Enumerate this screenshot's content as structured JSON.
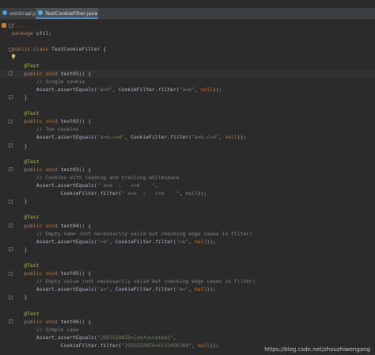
{
  "tabs": [
    {
      "label": "ootstrap.java",
      "close": "×",
      "icon": "class-icon",
      "active": false
    },
    {
      "label": "TestCookieFilter.java",
      "close": "×",
      "icon": "test-class-icon",
      "active": true
    }
  ],
  "code": [
    {
      "segments": [
        {
          "t": "/...",
          "c": "cmt"
        }
      ],
      "fold": true,
      "bookmark": true
    },
    {
      "segments": [
        {
          "t": "package",
          "c": "kw"
        },
        {
          "t": " util;",
          "c": ""
        }
      ]
    },
    {
      "segments": []
    },
    {
      "segments": [
        {
          "t": "public class ",
          "c": "kw"
        },
        {
          "t": "TestCookieFilter ",
          "c": ""
        },
        {
          "t": "{",
          "c": ""
        }
      ],
      "fold": true
    },
    {
      "segments": [
        {
          "t": "",
          "c": ""
        }
      ],
      "bulb": true
    },
    {
      "segments": [
        {
          "t": "    @Test",
          "c": "ann"
        }
      ]
    },
    {
      "segments": [
        {
          "t": "    public void ",
          "c": "kw"
        },
        {
          "t": "test01() {",
          "c": ""
        }
      ],
      "fold": true,
      "current": true
    },
    {
      "segments": [
        {
          "t": "        // Single cookie",
          "c": "cmt"
        }
      ]
    },
    {
      "segments": [
        {
          "t": "        Assert.",
          "c": ""
        },
        {
          "t": "assertEquals",
          "c": "ital"
        },
        {
          "t": "(",
          "c": ""
        },
        {
          "t": "\"a=b\"",
          "c": "str"
        },
        {
          "t": ", CookieFilter.",
          "c": ""
        },
        {
          "t": "filter",
          "c": "ital"
        },
        {
          "t": "(",
          "c": ""
        },
        {
          "t": "\"a=b\"",
          "c": "str"
        },
        {
          "t": ", ",
          "c": ""
        },
        {
          "t": "null",
          "c": "kw"
        },
        {
          "t": "));",
          "c": ""
        }
      ]
    },
    {
      "segments": [
        {
          "t": "    }",
          "c": ""
        }
      ],
      "fold": true
    },
    {
      "segments": []
    },
    {
      "segments": [
        {
          "t": "    @Test",
          "c": "ann"
        }
      ]
    },
    {
      "segments": [
        {
          "t": "    public void ",
          "c": "kw"
        },
        {
          "t": "test02() {",
          "c": ""
        }
      ],
      "fold": true
    },
    {
      "segments": [
        {
          "t": "        // Two cookies",
          "c": "cmt"
        }
      ]
    },
    {
      "segments": [
        {
          "t": "        Assert.",
          "c": ""
        },
        {
          "t": "assertEquals",
          "c": "ital"
        },
        {
          "t": "(",
          "c": ""
        },
        {
          "t": "\"a=b;c=d\"",
          "c": "str"
        },
        {
          "t": ", CookieFilter.",
          "c": ""
        },
        {
          "t": "filter",
          "c": "ital"
        },
        {
          "t": "(",
          "c": ""
        },
        {
          "t": "\"a=b;c=d\"",
          "c": "str"
        },
        {
          "t": ", ",
          "c": ""
        },
        {
          "t": "null",
          "c": "kw"
        },
        {
          "t": "));",
          "c": ""
        }
      ]
    },
    {
      "segments": [
        {
          "t": "    }",
          "c": ""
        }
      ],
      "fold": true
    },
    {
      "segments": []
    },
    {
      "segments": [
        {
          "t": "    @Test",
          "c": "ann"
        }
      ]
    },
    {
      "segments": [
        {
          "t": "    public void ",
          "c": "kw"
        },
        {
          "t": "test03() {",
          "c": ""
        }
      ],
      "fold": true
    },
    {
      "segments": [
        {
          "t": "        // Cookies with leading and trailing whitespace",
          "c": "cmt"
        }
      ]
    },
    {
      "segments": [
        {
          "t": "        Assert.",
          "c": ""
        },
        {
          "t": "assertEquals",
          "c": "ital"
        },
        {
          "t": "(",
          "c": ""
        },
        {
          "t": "\" a=b  ;   c=d    \"",
          "c": "str"
        },
        {
          "t": ",",
          "c": ""
        }
      ]
    },
    {
      "segments": [
        {
          "t": "                CookieFilter.",
          "c": ""
        },
        {
          "t": "filter",
          "c": "ital"
        },
        {
          "t": "(",
          "c": ""
        },
        {
          "t": "\" a=b  ;   c=d    \"",
          "c": "str"
        },
        {
          "t": ", ",
          "c": ""
        },
        {
          "t": "null",
          "c": "kw"
        },
        {
          "t": "));",
          "c": ""
        }
      ]
    },
    {
      "segments": [
        {
          "t": "    }",
          "c": ""
        }
      ],
      "fold": true
    },
    {
      "segments": []
    },
    {
      "segments": [
        {
          "t": "    @Test",
          "c": "ann"
        }
      ]
    },
    {
      "segments": [
        {
          "t": "    public void ",
          "c": "kw"
        },
        {
          "t": "test04() {",
          "c": ""
        }
      ],
      "fold": true
    },
    {
      "segments": [
        {
          "t": "        // Empty name (not necessarily valid but checking edge cases in filter)",
          "c": "cmt"
        }
      ]
    },
    {
      "segments": [
        {
          "t": "        Assert.",
          "c": ""
        },
        {
          "t": "assertEquals",
          "c": "ital"
        },
        {
          "t": "(",
          "c": ""
        },
        {
          "t": "\"=b\"",
          "c": "str"
        },
        {
          "t": ", CookieFilter.",
          "c": ""
        },
        {
          "t": "filter",
          "c": "ital"
        },
        {
          "t": "(",
          "c": ""
        },
        {
          "t": "\"=b\"",
          "c": "str"
        },
        {
          "t": ", ",
          "c": ""
        },
        {
          "t": "null",
          "c": "kw"
        },
        {
          "t": "));",
          "c": ""
        }
      ]
    },
    {
      "segments": [
        {
          "t": "    }",
          "c": ""
        }
      ],
      "fold": true
    },
    {
      "segments": []
    },
    {
      "segments": [
        {
          "t": "    @Test",
          "c": "ann"
        }
      ]
    },
    {
      "segments": [
        {
          "t": "    public void ",
          "c": "kw"
        },
        {
          "t": "test05() {",
          "c": ""
        }
      ],
      "fold": true
    },
    {
      "segments": [
        {
          "t": "        // Empty value (not necessarily valid but checking edge cases in filter)",
          "c": "cmt"
        }
      ]
    },
    {
      "segments": [
        {
          "t": "        Assert.",
          "c": ""
        },
        {
          "t": "assertEquals",
          "c": "ital"
        },
        {
          "t": "(",
          "c": ""
        },
        {
          "t": "\"a=\"",
          "c": "str"
        },
        {
          "t": ", CookieFilter.",
          "c": ""
        },
        {
          "t": "filter",
          "c": "ital"
        },
        {
          "t": "(",
          "c": ""
        },
        {
          "t": "\"a=\"",
          "c": "str"
        },
        {
          "t": ", ",
          "c": ""
        },
        {
          "t": "null",
          "c": "kw"
        },
        {
          "t": "));",
          "c": ""
        }
      ]
    },
    {
      "segments": [
        {
          "t": "    }",
          "c": ""
        }
      ],
      "fold": true
    },
    {
      "segments": []
    },
    {
      "segments": [
        {
          "t": "    @Test",
          "c": "ann"
        }
      ]
    },
    {
      "segments": [
        {
          "t": "    public void ",
          "c": "kw"
        },
        {
          "t": "test06() {",
          "c": ""
        }
      ],
      "fold": true
    },
    {
      "segments": [
        {
          "t": "        // Simple case",
          "c": "cmt"
        }
      ]
    },
    {
      "segments": [
        {
          "t": "        Assert.",
          "c": ""
        },
        {
          "t": "assertEquals",
          "c": "ital"
        },
        {
          "t": "(",
          "c": ""
        },
        {
          "t": "\"JSESSIONID=[obfuscated]\"",
          "c": "str"
        },
        {
          "t": ",",
          "c": ""
        }
      ]
    },
    {
      "segments": [
        {
          "t": "                CookieFilter.",
          "c": ""
        },
        {
          "t": "filter",
          "c": "ital"
        },
        {
          "t": "(",
          "c": ""
        },
        {
          "t": "\"JSESSIONID=0123456789\"",
          "c": "str"
        },
        {
          "t": ", ",
          "c": ""
        },
        {
          "t": "null",
          "c": "kw"
        },
        {
          "t": "));",
          "c": ""
        }
      ]
    }
  ],
  "watermark": "https://blog.csdn.net/zhouzhiwengang",
  "colors": {
    "background": "#2b2b2b",
    "keyword": "#cc7832",
    "annotation": "#bbb529",
    "string": "#6a8759",
    "comment": "#808080",
    "text": "#a9b7c6",
    "tab_accent": "#4a88c7"
  }
}
